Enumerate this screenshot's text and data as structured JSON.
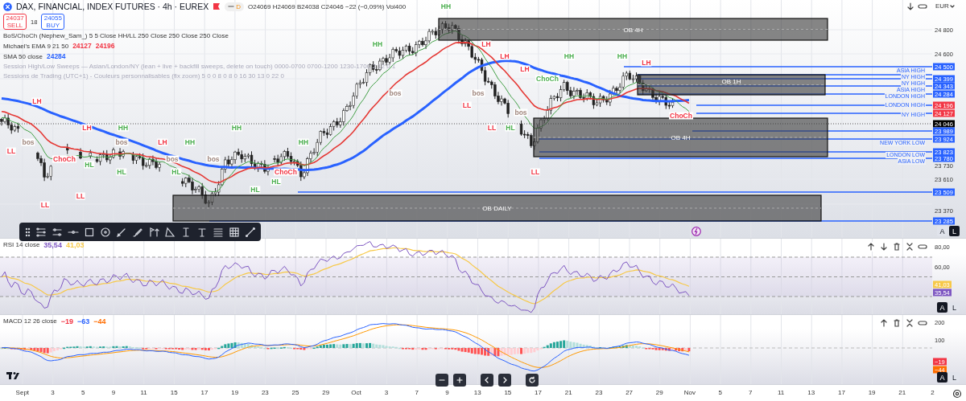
{
  "header": {
    "symbol": "DAX, FINANCIAL, INDEX FUTURES · 4h · EUREX",
    "badge": "D",
    "ohlc": "O24069 H24069 B24038 C24046 −22 (−0,09%) Vol400"
  },
  "trade": {
    "sell_price": "24037",
    "sell_label": "SELL",
    "spread": "18",
    "buy_price": "24055",
    "buy_label": "BUY"
  },
  "indicators": [
    {
      "name": "BoS/ChoCh (Nephew_Sam_) 5 5 Close HH/LL 250 Close 250 Close 250 Close",
      "visible": true
    },
    {
      "name": "Michael's EMA 9 21 50",
      "visible": true,
      "values": [
        {
          "text": "24127",
          "color": "#f23645"
        },
        {
          "text": "24196",
          "color": "#f23645"
        }
      ]
    },
    {
      "name": "SMA 50 close",
      "visible": true,
      "values": [
        {
          "text": "24284",
          "color": "#2962ff"
        }
      ]
    },
    {
      "name": "Session High/Low Sweeps — Asian/London/NY (lean + live + backfill sweeps, delete on touch) 0000-0700 0700-1200 1230-1700 2 12 0 1",
      "visible": false
    },
    {
      "name": "Sessions de Trading (UTC+1) - Couleurs personnalisables (fix zoom) 5 0 0 8 0 8 0 16 30 13 0 22 0",
      "visible": false
    }
  ],
  "currency": "EUR",
  "zones": [
    {
      "label": "OB 4H"
    },
    {
      "label": "OB 1H"
    },
    {
      "label": "OB 4H"
    },
    {
      "label": "OB DAILY"
    }
  ],
  "session_levels": [
    {
      "label": "ASIA HIGH"
    },
    {
      "label": "NY HIGH"
    },
    {
      "label": "NY HIGH"
    },
    {
      "label": "ASIA HIGH"
    },
    {
      "label": "LONDON HIGH"
    },
    {
      "label": "LONDON HIGH"
    },
    {
      "label": "NY HIGH"
    },
    {
      "label": "NEW YORK LOW"
    },
    {
      "label": "LONDON LOW"
    },
    {
      "label": "ASIA LOW"
    }
  ],
  "chart_markers": [
    {
      "text": "HH",
      "color": "#4caf50"
    },
    {
      "text": "HH",
      "color": "#4caf50"
    },
    {
      "text": "LH",
      "color": "#f23645"
    },
    {
      "text": "LH",
      "color": "#f23645"
    },
    {
      "text": "HH",
      "color": "#4caf50"
    },
    {
      "text": "HH",
      "color": "#4caf50"
    },
    {
      "text": "LH",
      "color": "#f23645"
    },
    {
      "text": "LH",
      "color": "#f23645"
    },
    {
      "text": "ChoCh",
      "color": "#4caf50"
    },
    {
      "text": "bos",
      "color": "#a1887f"
    },
    {
      "text": "bos",
      "color": "#a1887f"
    },
    {
      "text": "LH",
      "color": "#f23645"
    },
    {
      "text": "LL",
      "color": "#f23645"
    },
    {
      "text": "bos",
      "color": "#a1887f"
    },
    {
      "text": "ChoCh",
      "color": "#f23645"
    },
    {
      "text": "LH",
      "color": "#f23645"
    },
    {
      "text": "HH",
      "color": "#4caf50"
    },
    {
      "text": "HH",
      "color": "#4caf50"
    },
    {
      "text": "LL",
      "color": "#f23645"
    },
    {
      "text": "HL",
      "color": "#4caf50"
    },
    {
      "text": "bos",
      "color": "#a1887f"
    },
    {
      "text": "bos",
      "color": "#a1887f"
    },
    {
      "text": "LH",
      "color": "#f23645"
    },
    {
      "text": "HH",
      "color": "#4caf50"
    },
    {
      "text": "HH",
      "color": "#4caf50"
    },
    {
      "text": "LL",
      "color": "#f23645"
    },
    {
      "text": "ChoCh",
      "color": "#f23645"
    },
    {
      "text": "bos",
      "color": "#a1887f"
    },
    {
      "text": "bos",
      "color": "#a1887f"
    },
    {
      "text": "HL",
      "color": "#4caf50"
    },
    {
      "text": "HL",
      "color": "#4caf50"
    },
    {
      "text": "HL",
      "color": "#4caf50"
    },
    {
      "text": "ChoCh",
      "color": "#f23645"
    },
    {
      "text": "LL",
      "color": "#f23645"
    },
    {
      "text": "HL",
      "color": "#4caf50"
    },
    {
      "text": "LL",
      "color": "#f23645"
    },
    {
      "text": "HL",
      "color": "#4caf50"
    },
    {
      "text": "LL",
      "color": "#f23645"
    }
  ],
  "price_axis": [
    {
      "text": "24 800",
      "kind": "plain"
    },
    {
      "text": "24 600",
      "kind": "plain"
    },
    {
      "text": "24 500",
      "kind": "blue"
    },
    {
      "text": "24 399",
      "kind": "blue"
    },
    {
      "text": "24 343",
      "kind": "blue"
    },
    {
      "text": "24 284",
      "kind": "blue"
    },
    {
      "text": "24 196",
      "kind": "red"
    },
    {
      "text": "24 127",
      "kind": "red"
    },
    {
      "text": "24 046",
      "kind": "current"
    },
    {
      "text": "23 989",
      "kind": "blue"
    },
    {
      "text": "23 924",
      "kind": "blue"
    },
    {
      "text": "23 823",
      "kind": "blue"
    },
    {
      "text": "23 780",
      "kind": "blue"
    },
    {
      "text": "23 730",
      "kind": "plain"
    },
    {
      "text": "23 610",
      "kind": "plain"
    },
    {
      "text": "23 509",
      "kind": "blue"
    },
    {
      "text": "23 370",
      "kind": "plain"
    },
    {
      "text": "23 285",
      "kind": "blue"
    }
  ],
  "main_scale_buttons": [
    {
      "label": "A",
      "selected": false
    },
    {
      "label": "L",
      "selected": true
    }
  ],
  "rsi": {
    "title": "RSI 14 close",
    "values": [
      {
        "text": "35,54",
        "color": "#7e57c2"
      },
      {
        "text": "41,03",
        "color": "#f7c948"
      }
    ],
    "axis": [
      "80,00",
      "60,00"
    ],
    "tags": [
      {
        "text": "41,03",
        "color": "#f7c948"
      },
      {
        "text": "35,54",
        "color": "#7e57c2"
      }
    ],
    "scale_buttons": [
      {
        "label": "A",
        "selected": true
      },
      {
        "label": "L",
        "selected": false
      }
    ]
  },
  "macd": {
    "title": "MACD 12 26 close",
    "values": [
      {
        "text": "−19",
        "color": "#f23645"
      },
      {
        "text": "−63",
        "color": "#2962ff"
      },
      {
        "text": "−44",
        "color": "#ff6d00"
      }
    ],
    "axis": [
      "200",
      "100"
    ],
    "tags": [
      {
        "text": "−19",
        "color": "#f23645"
      },
      {
        "text": "−44",
        "color": "#ff6d00"
      }
    ],
    "scale_buttons": [
      {
        "label": "A",
        "selected": true
      },
      {
        "label": "L",
        "selected": false
      }
    ]
  },
  "time_axis": [
    "Sept",
    "3",
    "5",
    "9",
    "11",
    "15",
    "17",
    "19",
    "23",
    "25",
    "29",
    "Oct",
    "3",
    "7",
    "9",
    "13",
    "15",
    "17",
    "21",
    "23",
    "27",
    "29",
    "Nov",
    "5",
    "7",
    "11",
    "13",
    "17",
    "19",
    "21",
    "2"
  ]
}
